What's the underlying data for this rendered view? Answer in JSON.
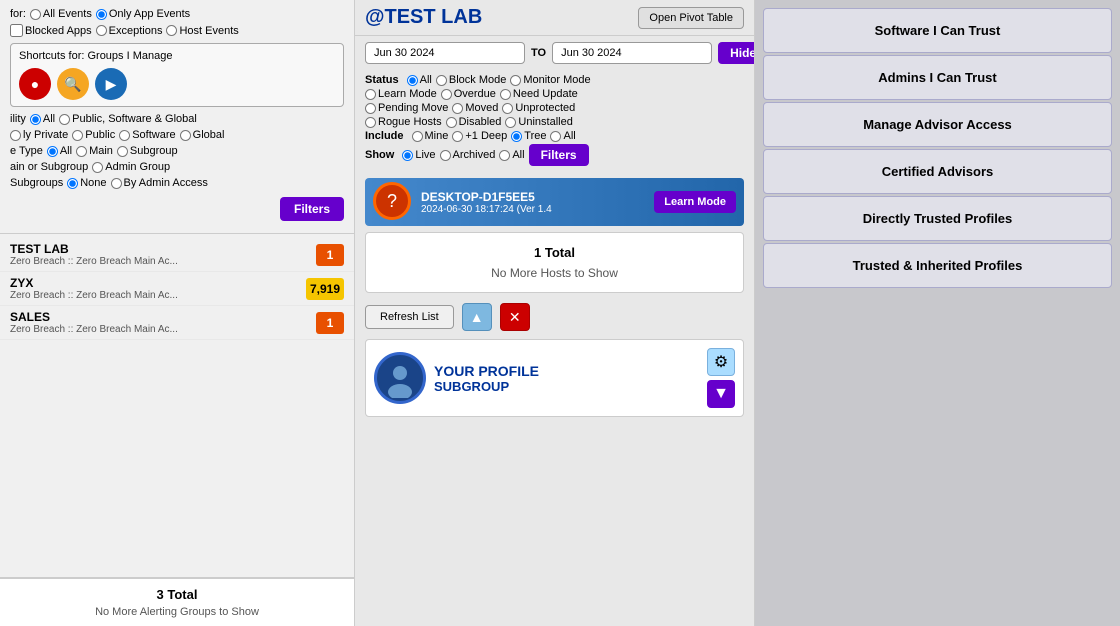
{
  "left": {
    "filter_for_label": "for:",
    "filter_options": [
      "All Events",
      "Only App Events"
    ],
    "filter_options_selected": "Only App Events",
    "blocked_apps_label": "Blocked Apps",
    "exceptions_label": "Exceptions",
    "host_events_label": "Host Events",
    "shortcuts_label": "Shortcuts for: Groups I Manage",
    "visibility_label": "ility",
    "visibility_options": [
      "All",
      "Public, Software & Global"
    ],
    "private_options": [
      "ly Private",
      "Public",
      "Software",
      "Global"
    ],
    "group_type_label": "e Type",
    "group_type_options": [
      "All",
      "Main",
      "Subgroup"
    ],
    "main_or_subgroup_label": "ain or Subgroup",
    "admin_group_option": "Admin Group",
    "subgroups_label": "Subgroups",
    "subgroups_options": [
      "None",
      "By Admin Access"
    ],
    "filters_btn": "Filters",
    "groups": [
      {
        "name": "TEST LAB",
        "sub": "Zero Breach :: Zero Breach Main Ac...",
        "badge": "1",
        "badge_type": "orange"
      },
      {
        "name": "ZYX",
        "sub": "Zero Breach :: Zero Breach Main Ac...",
        "badge": "7,919",
        "badge_type": "yellow"
      },
      {
        "name": "SALES",
        "sub": "Zero Breach :: Zero Breach Main Ac...",
        "badge": "1",
        "badge_type": "orange"
      }
    ],
    "summary_total": "3 Total",
    "summary_msg": "No More Alerting Groups to Show"
  },
  "mid": {
    "title": "@TEST LAB",
    "pivot_btn": "Open Pivot Table",
    "date_from": "Jun 30 2024",
    "date_to": "Jun 30 2024",
    "to_label": "TO",
    "hide_btn": "Hide",
    "status_label": "Status",
    "status_options": [
      "All",
      "Block Mode",
      "Monitor Mode",
      "Learn Mode",
      "Overdue",
      "Need Update",
      "Pending Move",
      "Moved",
      "Unprotected",
      "Rogue Hosts",
      "Disabled",
      "Uninstalled"
    ],
    "include_label": "Include",
    "include_options": [
      "Mine",
      "+1 Deep",
      "Tree",
      "All"
    ],
    "include_selected": "Tree",
    "show_label": "Show",
    "show_options": [
      "Live",
      "Archived",
      "All"
    ],
    "show_selected": "Live",
    "filters_btn": "Filters",
    "host": {
      "name": "DESKTOP-D1F5EE5",
      "date": "2024-06-30 18:17:24 (Ver 1.4",
      "mode_btn": "Learn Mode"
    },
    "hosts_total": "1 Total",
    "hosts_msg": "No More Hosts to Show",
    "refresh_btn": "Refresh List",
    "profile": {
      "title": "YOUR PROFILE",
      "subtitle": "SUBGROUP"
    }
  },
  "right": {
    "buttons": [
      "Software I Can Trust",
      "Admins I Can Trust",
      "Manage Advisor Access",
      "Certified Advisors",
      "Directly Trusted Profiles",
      "Trusted & Inherited Profiles"
    ]
  }
}
